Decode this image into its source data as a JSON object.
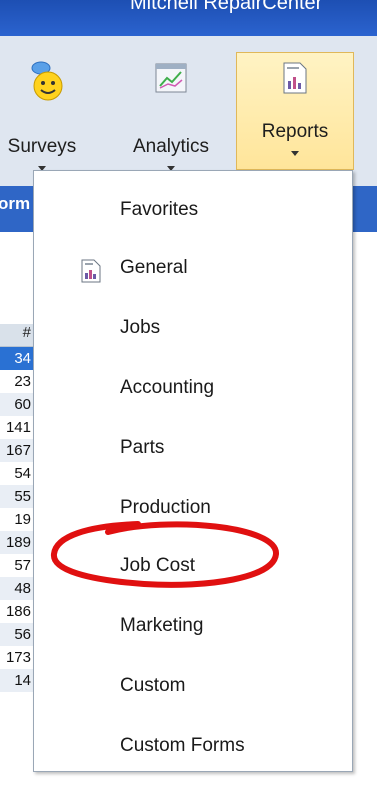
{
  "window": {
    "title": "Mitchell RepairCenter"
  },
  "ribbon": {
    "surveys_label": "Surveys",
    "analytics_label": "Analytics",
    "reports_label": "Reports"
  },
  "subband": {
    "label": "orm"
  },
  "grid": {
    "header": "#",
    "cells": [
      "34",
      "23",
      "60",
      "141",
      "167",
      "54",
      "55",
      "19",
      "189",
      "57",
      "48",
      "186",
      "56",
      "173",
      "14"
    ]
  },
  "menu": {
    "items": [
      {
        "label": "Favorites",
        "icon": ""
      },
      {
        "label": "General",
        "icon": "report-icon"
      },
      {
        "label": "Jobs",
        "icon": ""
      },
      {
        "label": "Accounting",
        "icon": ""
      },
      {
        "label": "Parts",
        "icon": ""
      },
      {
        "label": "Production",
        "icon": ""
      },
      {
        "label": "Job Cost",
        "icon": ""
      },
      {
        "label": "Marketing",
        "icon": ""
      },
      {
        "label": "Custom",
        "icon": ""
      },
      {
        "label": "Custom Forms",
        "icon": ""
      }
    ]
  },
  "colors": {
    "titlebar": "#1d4fb3",
    "ribbon": "#dfe6f0",
    "selected_button": "#ffe59a",
    "annotation": "#e01010"
  }
}
